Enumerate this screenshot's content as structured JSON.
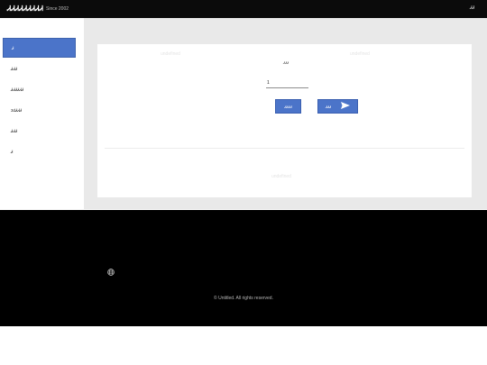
{
  "header": {
    "brand": "ᏗᏗᏗᏗᏗᏗᏗᏗᏗ",
    "since": "Since 2002",
    "right_icon": "",
    "right_label": " ᏗᏗ"
  },
  "sidebar": {
    "items": [
      {
        "label": "Ꮧ",
        "active": true
      },
      {
        "label": "ᏗᏗᏗ"
      },
      {
        "label": "ᏗᏗᏗᏗᏗᏗ"
      },
      {
        "label": "3dᏗᏗᏗ"
      },
      {
        "label": "ᏗᏗᏗ"
      },
      {
        "label": "Ꮧ"
      }
    ]
  },
  "main": {
    "col_heading_1": "undefined",
    "col_heading_2": "undefined",
    "form_label": "ᏗᏗᏗ",
    "quantity_value": "1",
    "button_1_label": "ᏗᏗᏗᏗ",
    "button_2_label": "ᏗᏗᏗ",
    "card_footer": "undefined"
  },
  "footer": {
    "icon_1": "",
    "icon_2": "",
    "copyright": "© Untitled. All rights reserved."
  },
  "colors": {
    "topbar": "#0b0b0b",
    "accent": "#4b74c9",
    "content_bg": "#e9e9e9",
    "footer": "#000000"
  }
}
